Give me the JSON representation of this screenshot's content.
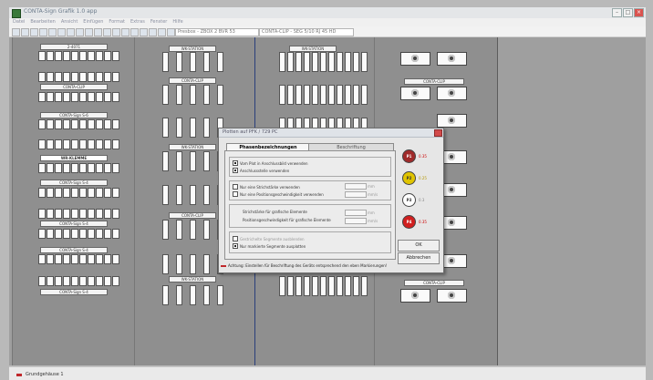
{
  "window": {
    "title": "CONTA-Sign Grafik 1.0 app",
    "controls": [
      "–",
      "□",
      "×"
    ]
  },
  "menu": {
    "items": [
      "Datei",
      "Bearbeiten",
      "Ansicht",
      "Einfügen",
      "Format",
      "Extras",
      "Fenster",
      "Hilfe"
    ]
  },
  "toolbar": {
    "profile_select": "Presbox - ZBOX 2 BVR 53",
    "series_select": "CONTA-CLIP - SEG 5/10 RJ 45 HD"
  },
  "workspace": {
    "panel1_labels": [
      "2-4071",
      "CONTA-CLIP",
      "CONTA-Sign S-6",
      "WR-KLEMME",
      "CONTA-Sign S-4",
      "CONTA-Sign S-4",
      "CONTA-Sign S-4",
      "CONTA-Sign S-4"
    ],
    "panel2_labels": [
      "WK-STATION",
      "CONTA-CLIP",
      "WK-STATION",
      "CONTA-CLIP",
      "WK-STATION"
    ],
    "panel3_labels": [
      "WK-STATION"
    ],
    "panel4_labels": [
      "CONTA-CLIP",
      "CONTA-CLIP"
    ]
  },
  "dialog": {
    "title": "Plotten auf PFK / 729 PC",
    "tabs": [
      "Phasenbezeichnungen",
      "Beschriftung"
    ],
    "options": [
      {
        "label": "Vom Plot in Anschlussbild verwenden",
        "checked": true
      },
      {
        "label": "Anschlussstelle verwenden",
        "checked": true
      },
      {
        "label": "Nur eine Strichstärke verwenden",
        "checked": false
      },
      {
        "label": "Nur eine Positionsgeschwindigkeit verwenden",
        "checked": false
      }
    ],
    "field_labels": [
      "Strichstärke für grafische Elemente",
      "Positionsgeschwindigkeit für grafische Elemente"
    ],
    "units": [
      "mm",
      "mm/s",
      "mm",
      "mm/s"
    ],
    "bottom_options": [
      {
        "label": "Gestrichelte Segmente ausblenden",
        "checked": false,
        "disabled": true
      },
      {
        "label": "Nur markierte Segmente ausplotten",
        "checked": true,
        "disabled": false
      }
    ],
    "pens": [
      {
        "id": "P1",
        "color": "#a02a2a",
        "value": "0.35"
      },
      {
        "id": "P2",
        "color": "#e0c400",
        "value": "0.25"
      },
      {
        "id": "P3",
        "color": "#ffffff",
        "value": "0.3"
      },
      {
        "id": "P4",
        "color": "#d11f1f",
        "value": "0.35"
      }
    ],
    "ok_label": "OK",
    "cancel_label": "Abbrechen",
    "footer_note": "Achtung: Einstellen für Beschriftung des Geräts entsprechend den eben Markierungen!"
  },
  "status": {
    "text": "Grundgehäuse 1"
  }
}
